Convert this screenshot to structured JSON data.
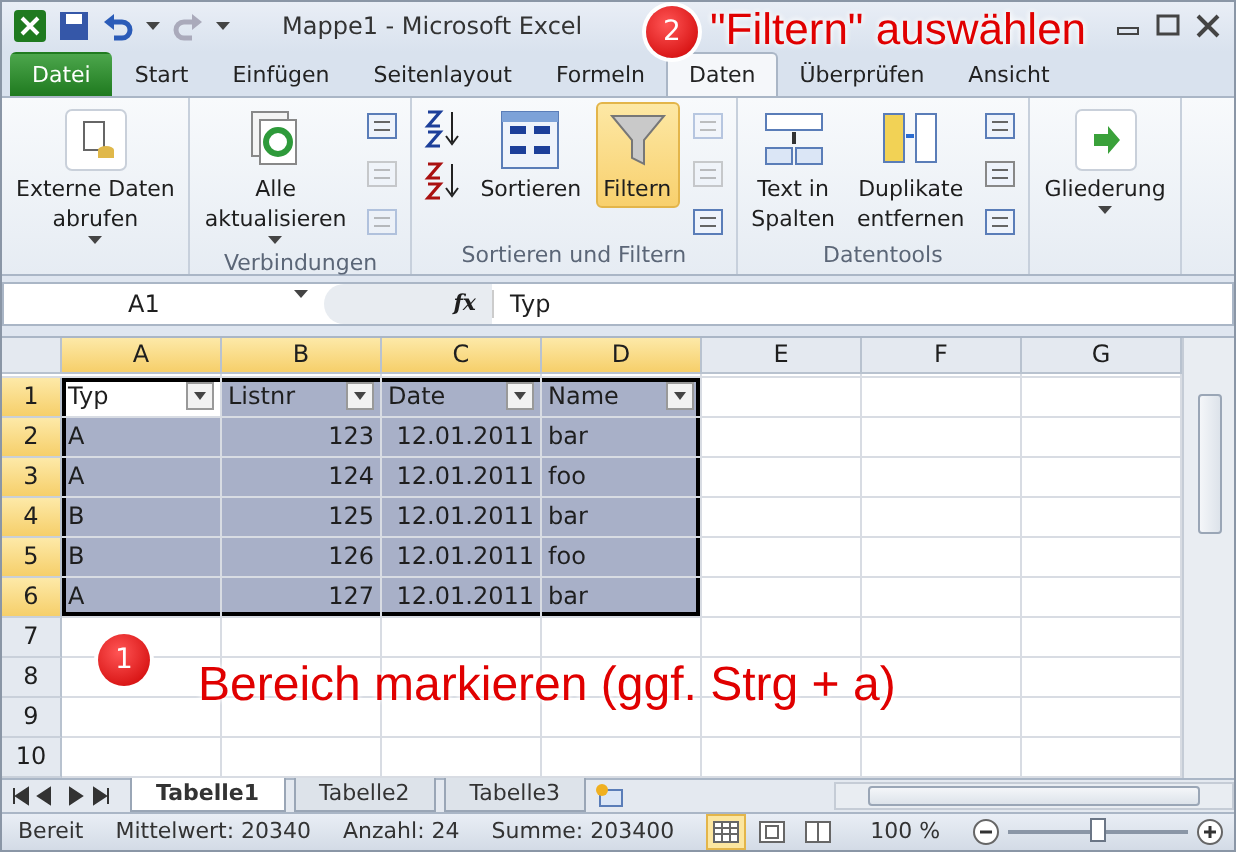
{
  "window": {
    "title": "Mappe1 - Microsoft Excel"
  },
  "ribbon_tabs": [
    {
      "label": "Datei",
      "kind": "file",
      "selected": false
    },
    {
      "label": "Start",
      "kind": "tab",
      "selected": false
    },
    {
      "label": "Einfügen",
      "kind": "tab",
      "selected": false
    },
    {
      "label": "Seitenlayout",
      "kind": "tab",
      "selected": false
    },
    {
      "label": "Formeln",
      "kind": "tab",
      "selected": false
    },
    {
      "label": "Daten",
      "kind": "tab",
      "selected": true
    },
    {
      "label": "Überprüfen",
      "kind": "tab",
      "selected": false
    },
    {
      "label": "Ansicht",
      "kind": "tab",
      "selected": false
    }
  ],
  "ribbon_groups": [
    {
      "items": [
        {
          "kind": "large",
          "lines": [
            "Externe Daten",
            "abrufen"
          ],
          "caret": true,
          "selected": false
        }
      ]
    },
    {
      "label": "Verbindungen",
      "items": [
        {
          "kind": "large",
          "lines": [
            "Alle",
            "aktualisieren"
          ],
          "caret": true,
          "selected": false
        },
        {
          "kind": "smallstack",
          "icons": [
            {
              "disabled": false
            },
            {
              "disabled": true
            },
            {
              "disabled": true
            }
          ]
        }
      ]
    },
    {
      "label": "Sortieren und Filtern",
      "items": [
        {
          "kind": "sortstack"
        },
        {
          "kind": "large",
          "lines": [
            "Sortieren"
          ],
          "caret": false,
          "selected": false
        },
        {
          "kind": "large",
          "lines": [
            "Filtern"
          ],
          "caret": false,
          "selected": true
        },
        {
          "kind": "smallstack",
          "icons": [
            {
              "disabled": true
            },
            {
              "disabled": true
            },
            {
              "disabled": false
            }
          ]
        }
      ]
    },
    {
      "label": "Datentools",
      "items": [
        {
          "kind": "large",
          "lines": [
            "Text in",
            "Spalten"
          ],
          "caret": false,
          "selected": false
        },
        {
          "kind": "large",
          "lines": [
            "Duplikate",
            "entfernen"
          ],
          "caret": false,
          "selected": false
        },
        {
          "kind": "smallstack",
          "icons": [
            {
              "disabled": false
            },
            {
              "disabled": false
            },
            {
              "disabled": false
            }
          ]
        }
      ]
    },
    {
      "items": [
        {
          "kind": "large",
          "lines": [
            "Gliederung"
          ],
          "caret": true,
          "selected": false
        }
      ]
    }
  ],
  "name_box": "A1",
  "function_label": "fx",
  "formula": "Typ",
  "columns": [
    {
      "label": "A",
      "selected": true
    },
    {
      "label": "B",
      "selected": true
    },
    {
      "label": "C",
      "selected": true
    },
    {
      "label": "D",
      "selected": true
    },
    {
      "label": "E",
      "selected": false
    },
    {
      "label": "F",
      "selected": false
    },
    {
      "label": "G",
      "selected": false
    }
  ],
  "rows": [
    {
      "number": "1",
      "selected": true,
      "cells": [
        "Typ",
        "Listnr",
        "Date",
        "Name"
      ],
      "header": true
    },
    {
      "number": "2",
      "selected": true,
      "cells": [
        "A",
        "123",
        "12.01.2011",
        "bar"
      ]
    },
    {
      "number": "3",
      "selected": true,
      "cells": [
        "A",
        "124",
        "12.01.2011",
        "foo"
      ]
    },
    {
      "number": "4",
      "selected": true,
      "cells": [
        "B",
        "125",
        "12.01.2011",
        "bar"
      ]
    },
    {
      "number": "5",
      "selected": true,
      "cells": [
        "B",
        "126",
        "12.01.2011",
        "foo"
      ]
    },
    {
      "number": "6",
      "selected": true,
      "cells": [
        "A",
        "127",
        "12.01.2011",
        "bar"
      ]
    },
    {
      "number": "7",
      "selected": false,
      "cells": []
    },
    {
      "number": "8",
      "selected": false,
      "cells": []
    },
    {
      "number": "9",
      "selected": false,
      "cells": []
    },
    {
      "number": "10",
      "selected": false,
      "cells": []
    }
  ],
  "sheet_tabs": [
    {
      "label": "Tabelle1",
      "selected": true
    },
    {
      "label": "Tabelle2",
      "selected": false
    },
    {
      "label": "Tabelle3",
      "selected": false
    }
  ],
  "status_bar": {
    "mode": "Bereit",
    "stats": [
      "Mittelwert: 20340",
      "Anzahl: 24",
      "Summe: 203400"
    ],
    "views": [
      {
        "selected": true
      },
      {
        "selected": false
      },
      {
        "selected": false
      }
    ],
    "zoom": "100 %",
    "zoom_slider": {
      "level": 0.5
    }
  },
  "annotations": [
    {
      "number": "2",
      "text": "\"Filtern\" auswählen"
    },
    {
      "number": "1",
      "text": "Bereich markieren (ggf. Strg + a)"
    }
  ]
}
